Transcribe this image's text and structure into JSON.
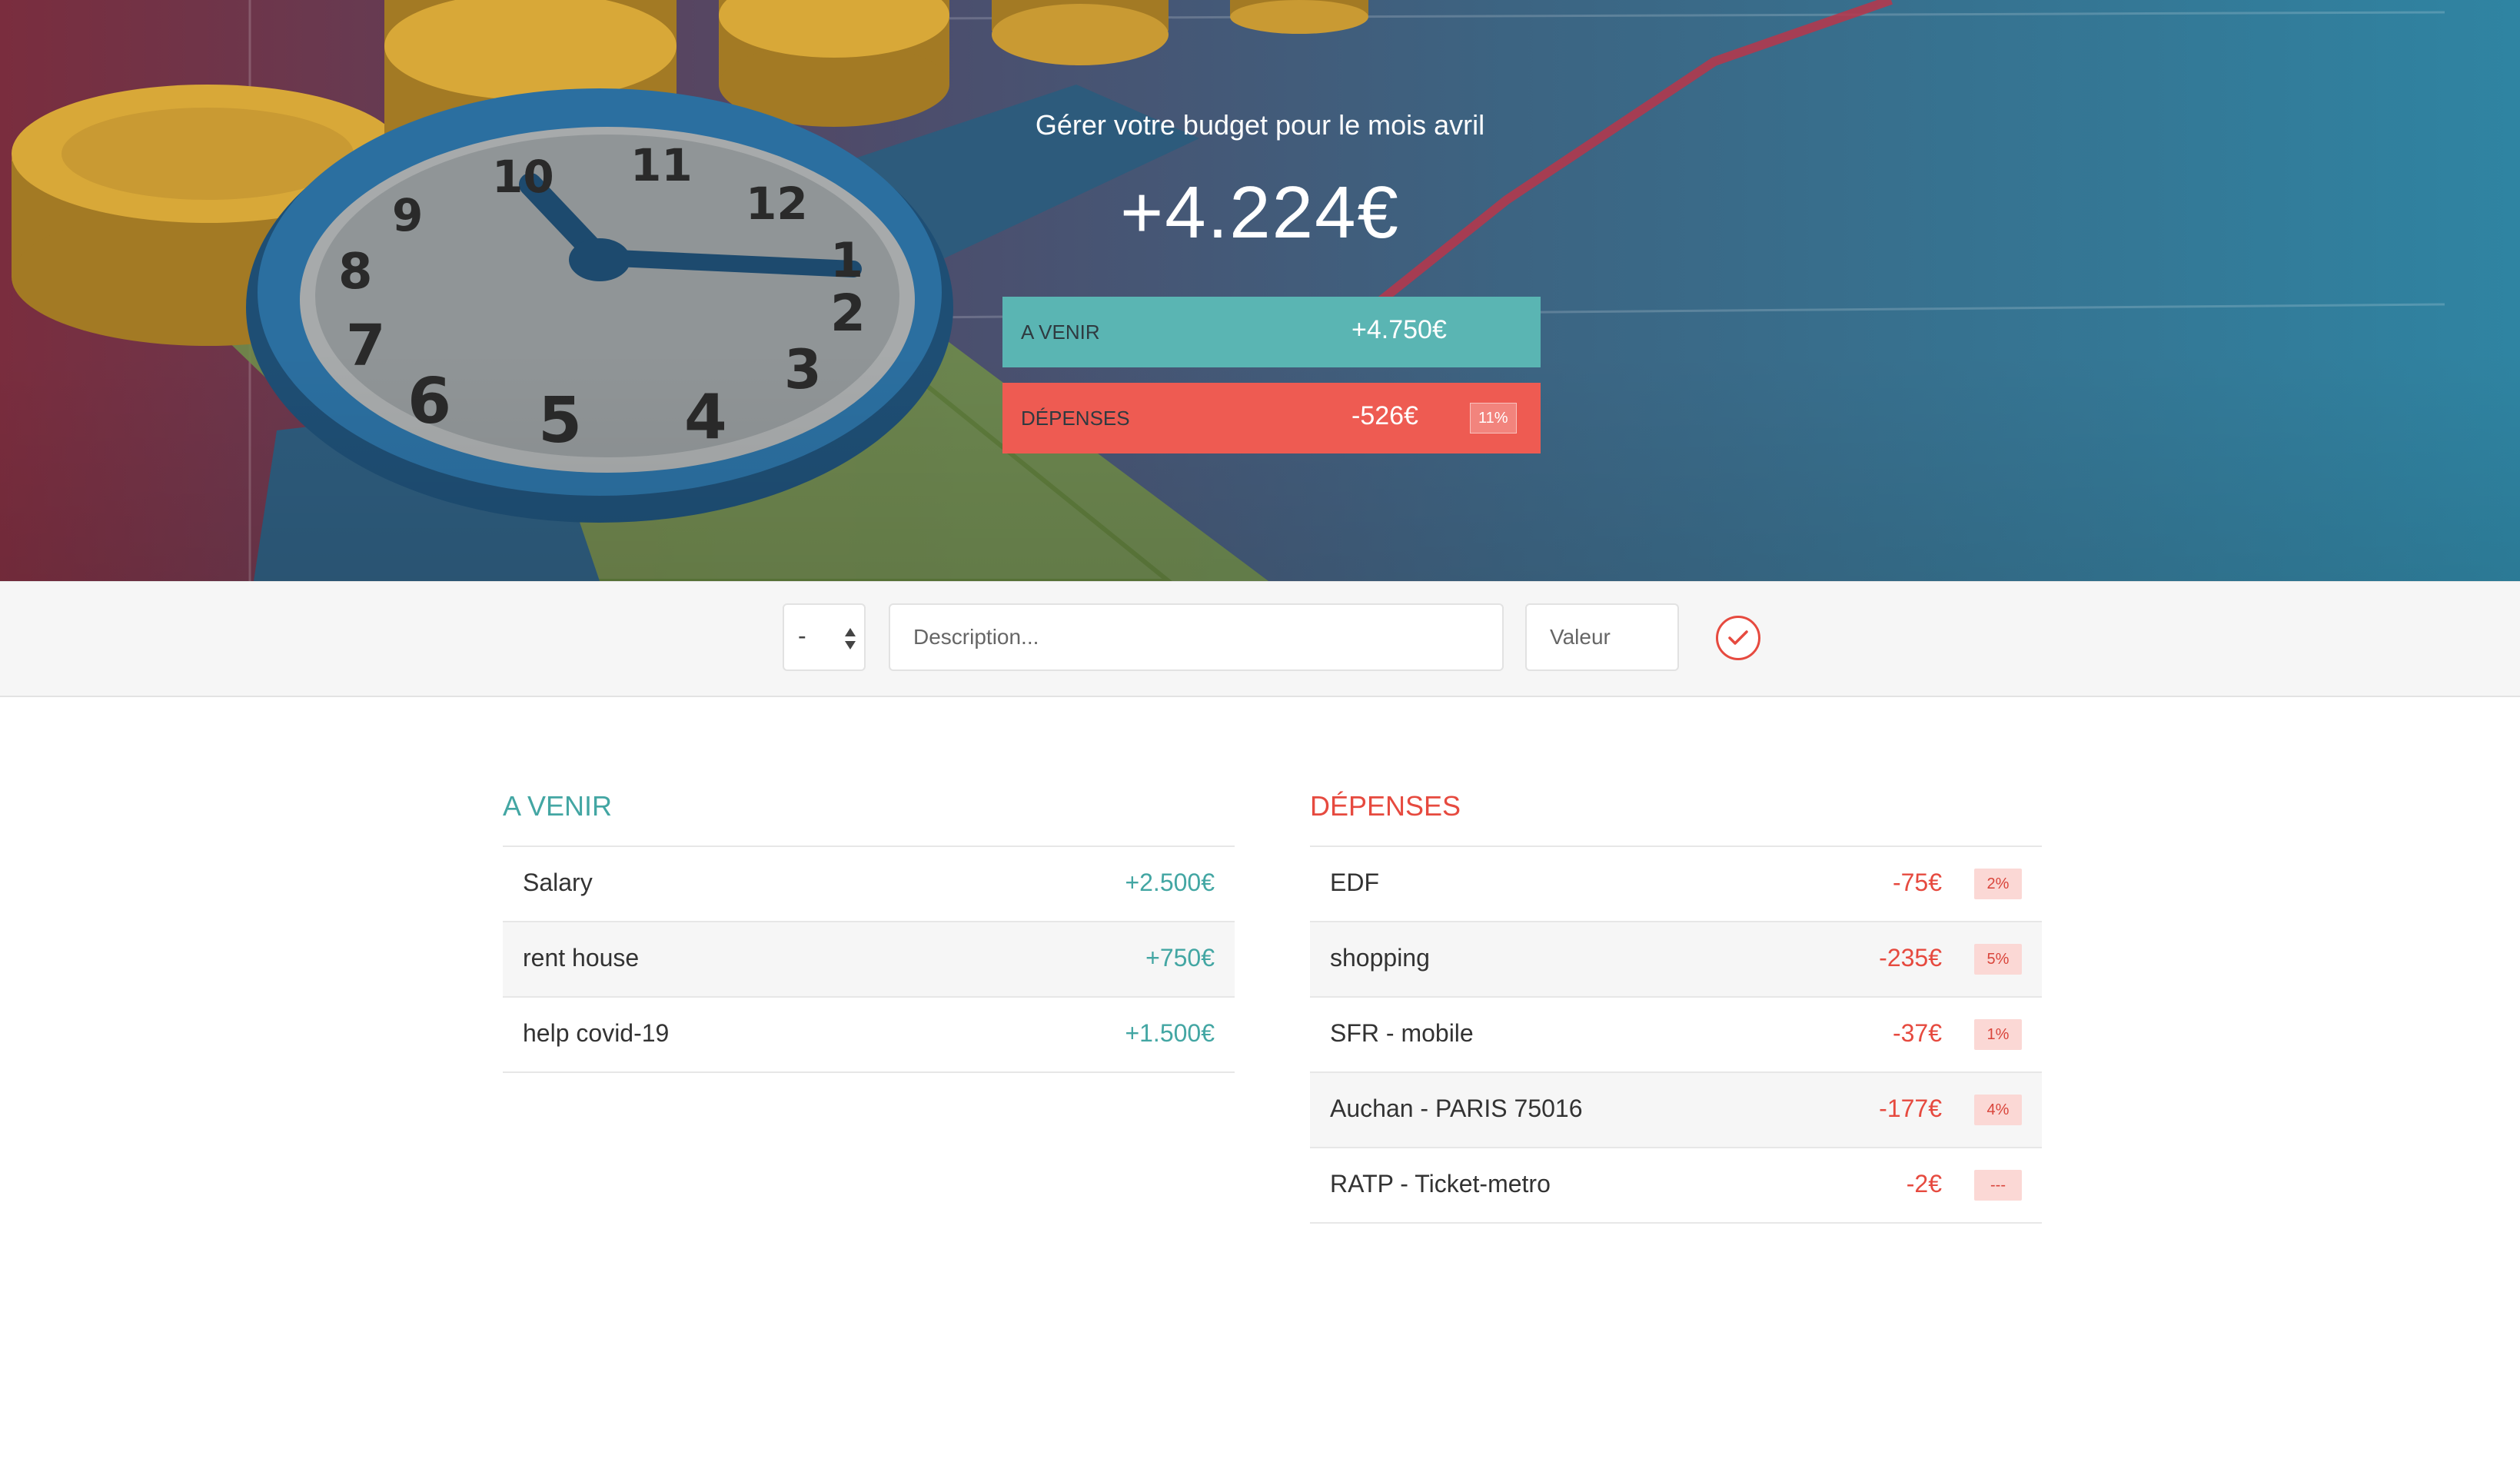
{
  "hero": {
    "title": "Gérer votre budget pour le mois avril",
    "total": "+4.224€",
    "income": {
      "label": "A VENIR",
      "value": "+4.750€"
    },
    "expenses": {
      "label": "DÉPENSES",
      "value": "-526€",
      "percent": "11%"
    }
  },
  "form": {
    "type_value": "-",
    "description_placeholder": "Description...",
    "value_placeholder": "Valeur",
    "submit_icon": "check-circle-icon"
  },
  "income": {
    "title": "A VENIR",
    "items": [
      {
        "description": "Salary",
        "value": "+2.500€"
      },
      {
        "description": "rent house",
        "value": "+750€"
      },
      {
        "description": "help covid-19",
        "value": "+1.500€"
      }
    ]
  },
  "expenses": {
    "title": "DÉPENSES",
    "items": [
      {
        "description": "EDF",
        "value": "-75€",
        "percent": "2%"
      },
      {
        "description": "shopping",
        "value": "-235€",
        "percent": "5%"
      },
      {
        "description": "SFR - mobile",
        "value": "-37€",
        "percent": "1%"
      },
      {
        "description": "Auchan - PARIS 75016",
        "value": "-177€",
        "percent": "4%"
      },
      {
        "description": "RATP - Ticket-metro",
        "value": "-2€",
        "percent": "---"
      }
    ]
  },
  "colors": {
    "income": "#5ab5b3",
    "expense": "#ee5b52",
    "income_text": "#43a6a3",
    "expense_text": "#e64a3f"
  }
}
